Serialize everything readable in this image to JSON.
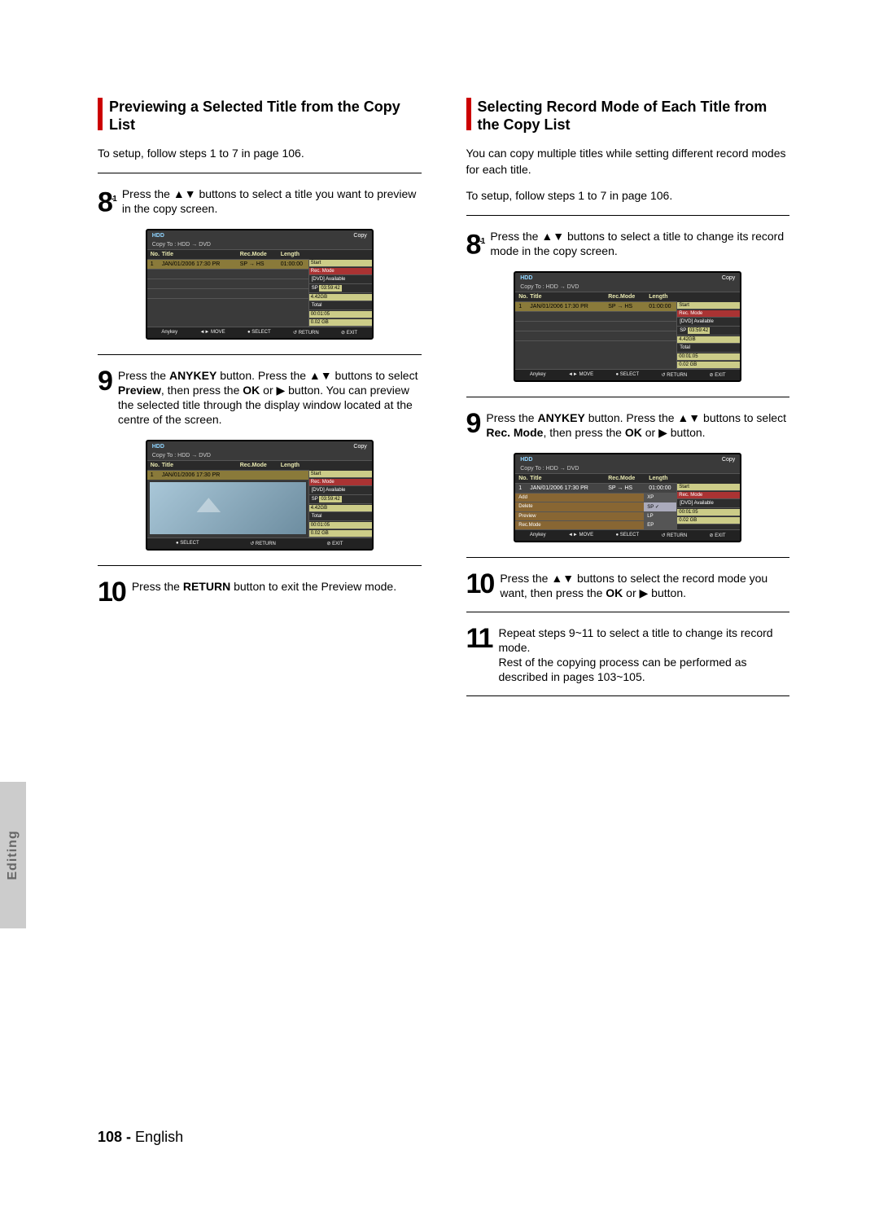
{
  "side_tab": "Editing",
  "footer": {
    "page": "108 -",
    "lang": "English"
  },
  "left": {
    "heading": "Previewing a Selected Title from the Copy List",
    "intro": "To setup, follow steps 1 to 7 in page 106.",
    "step8_num": "8",
    "step8_sup": "-1",
    "step8_text": "Press the ▲▼ buttons to select a title you want to preview in the copy screen.",
    "step9_num": "9",
    "step9_text_a": "Press the ",
    "step9_text_b": "ANYKEY",
    "step9_text_c": " button. Press the ▲▼ buttons to select ",
    "step9_text_d": "Preview",
    "step9_text_e": ", then press the ",
    "step9_text_f": "OK",
    "step9_text_g": " or ▶ button. You can preview the selected title through the display window located at the centre of the screen.",
    "step10_num": "10",
    "step10_text_a": "Press the ",
    "step10_text_b": "RETURN",
    "step10_text_c": " button to exit the Preview mode."
  },
  "right": {
    "heading": "Selecting Record Mode of Each Title from the Copy List",
    "intro1": "You can copy multiple titles while setting different record modes for each title.",
    "intro2": "To setup, follow steps 1 to 7 in page 106.",
    "step8_num": "8",
    "step8_sup": "-1",
    "step8_text": "Press the ▲▼ buttons to select a title to change its record mode in the copy screen.",
    "step9_num": "9",
    "step9_text_a": "Press the ",
    "step9_text_b": "ANYKEY",
    "step9_text_c": " button. Press the ▲▼ buttons to select ",
    "step9_text_d": "Rec. Mode",
    "step9_text_e": ", then press the ",
    "step9_text_f": "OK",
    "step9_text_g": " or ▶ button.",
    "step10_num": "10",
    "step10_text_a": "Press the ▲▼ buttons to select the record mode you want, then press the ",
    "step10_text_b": "OK",
    "step10_text_c": " or ▶ button.",
    "step11_num": "11",
    "step11_text": "Repeat steps 9~11 to select a title to change its record mode.\nRest of the copying process can be performed as described in pages 103~105."
  },
  "osd": {
    "hdd": "HDD",
    "copy": "Copy",
    "copyto": "Copy To : HDD  →  DVD",
    "head_no": "No.",
    "head_title": "Title",
    "head_rm": "Rec.Mode",
    "head_len": "Length",
    "row_no": "1",
    "row_title": "JAN/01/2006 17:30 PR",
    "row_rm": "SP → HS",
    "row_len": "01:00:00",
    "side_start": "Start",
    "side_recmode": "Rec. Mode",
    "side_avail": "[DVD] Available",
    "side_sp": "SP",
    "side_time": "03:59:42",
    "side_size": "4.42GB",
    "side_total": "Total",
    "side_tot_time": "00:01:05",
    "side_tot_size": "0.02 GB",
    "foot_anykey": "Anykey",
    "foot_move": "◄► MOVE",
    "foot_select": "● SELECT",
    "foot_return": "↺ RETURN",
    "foot_exit": "⊘ EXIT",
    "menu_add": "Add",
    "menu_delete": "Delete",
    "menu_preview": "Preview",
    "menu_recmode": "Rec.Mode",
    "mode_xp": "XP",
    "mode_sp": "SP",
    "mode_lp": "LP",
    "mode_ep": "EP"
  }
}
